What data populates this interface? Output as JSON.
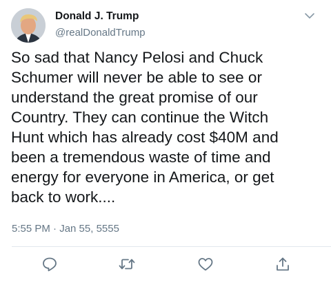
{
  "tweet": {
    "author_name": "Donald J. Trump",
    "author_handle": "@realDonaldTrump",
    "text_lines": [
      "So sad that Nancy Pelosi and Chuck",
      "Schumer will never be able to see or",
      "understand the great promise of our",
      "Country. They can continue the Witch",
      "Hunt which has already cost $40M and",
      "been a tremendous waste of time and",
      "energy for everyone in America, or get",
      "back to work...."
    ],
    "timestamp": "5:55 PM · Jan 55, 5555"
  },
  "icons": {
    "menu": "chevron-down-icon",
    "reply": "reply-icon",
    "retweet": "retweet-icon",
    "like": "like-icon",
    "share": "share-icon"
  },
  "colors": {
    "text": "#14171a",
    "secondary": "#657786",
    "icon": "#657786",
    "divider": "#e1e8ed"
  }
}
